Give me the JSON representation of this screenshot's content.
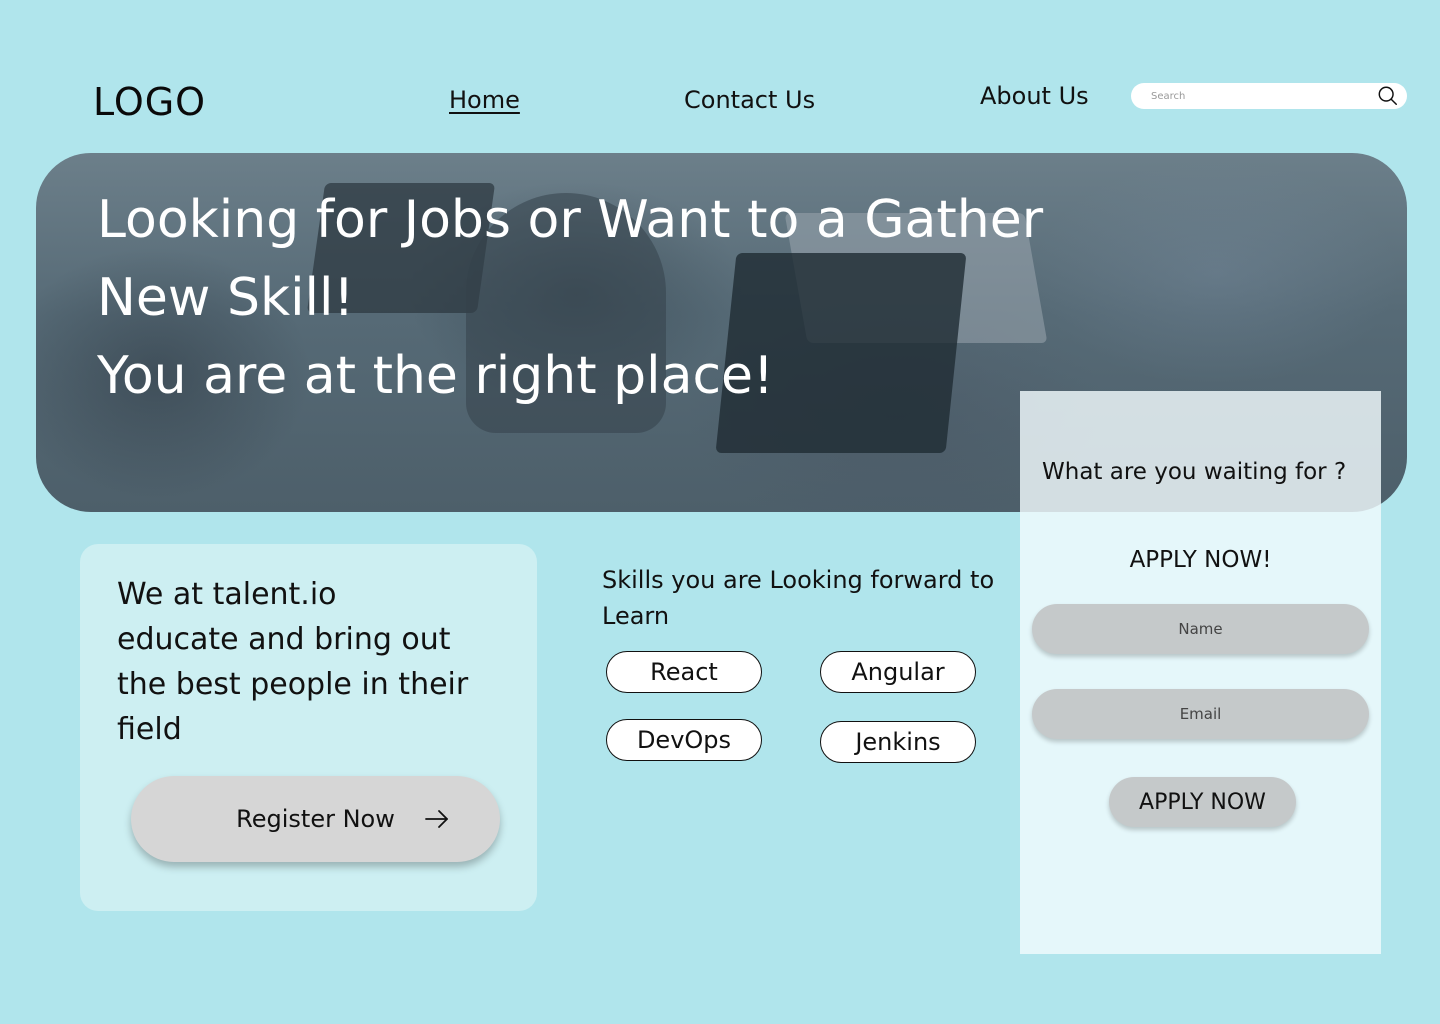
{
  "header": {
    "logo": "LOGO",
    "nav": {
      "home": "Home",
      "contact": "Contact Us",
      "about": "About Us"
    },
    "search": {
      "placeholder": "Search",
      "icon": "search-icon"
    }
  },
  "hero": {
    "line1": "Looking for Jobs or Want to a Gather",
    "line2": "New Skill!",
    "line3": "You are at the right place!"
  },
  "intro": {
    "line1": "We at talent.io",
    "line2": "educate and bring out",
    "line3": "the best people in their",
    "line4": "field",
    "register_label": "Register Now",
    "register_icon": "arrow-right-icon"
  },
  "skills": {
    "heading_line1": "Skills you are Looking forward to",
    "heading_line2": "Learn",
    "items": [
      "React",
      "Angular",
      "DevOps",
      "Jenkins"
    ]
  },
  "apply": {
    "question": "What are you waiting for ?",
    "title": "APPLY NOW!",
    "name_placeholder": "Name",
    "email_placeholder": "Email",
    "button_label": "APPLY NOW"
  },
  "colors": {
    "background": "#b0e5ec",
    "card": "#cdeff2",
    "button_grey": "#d6d6d6",
    "field_grey": "#c5c9ca"
  }
}
